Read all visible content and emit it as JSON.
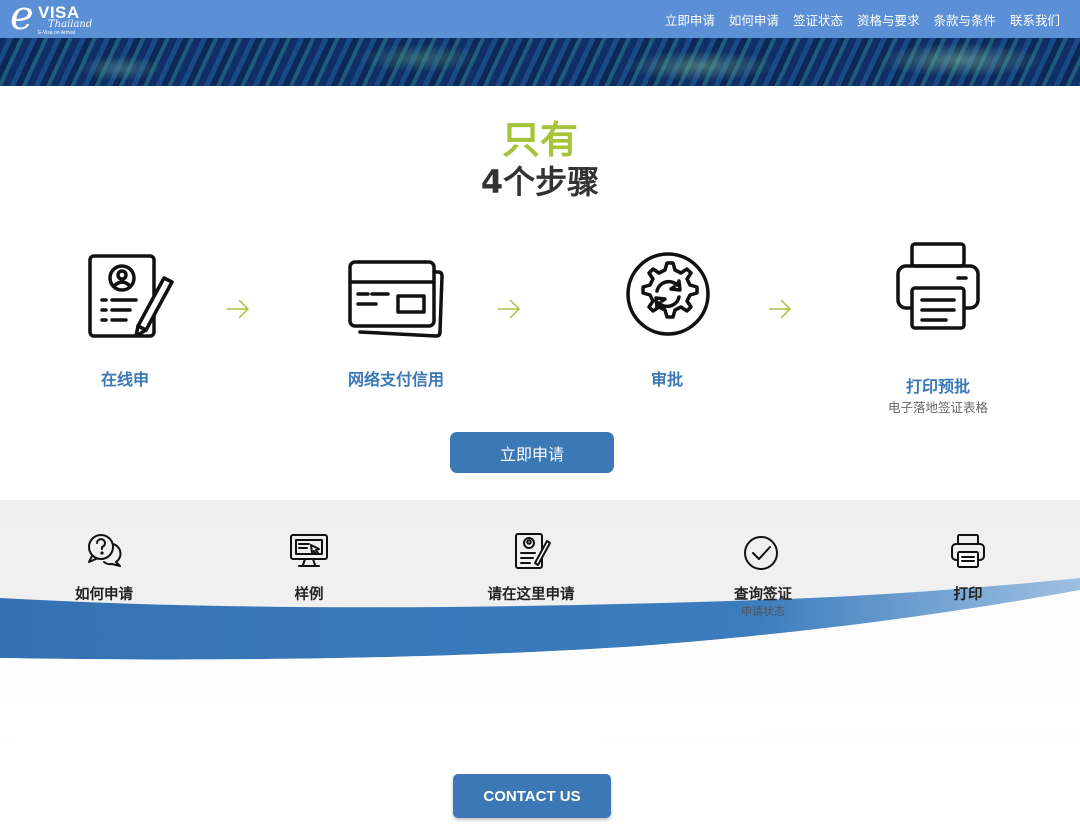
{
  "header": {
    "logo": {
      "e": "e",
      "visa": "VISA",
      "country": "Thailand",
      "tagline": "E-Visa on Arrival"
    },
    "nav": [
      "立即申请",
      "如何申请",
      "签证状态",
      "资格与要求",
      "条款与条件",
      "联系我们"
    ]
  },
  "hero": {
    "line1": "只有",
    "line2": "4个步骤"
  },
  "steps": [
    {
      "icon": "application-form-icon",
      "label": "在线申",
      "sub": ""
    },
    {
      "icon": "credit-card-icon",
      "label": "网络支付信用",
      "sub": ""
    },
    {
      "icon": "approval-gear-icon",
      "label": "审批",
      "sub": ""
    },
    {
      "icon": "printer-icon",
      "label": "打印预批",
      "sub": "电子落地签证表格"
    }
  ],
  "apply_button": "立即申请",
  "quick_links": [
    {
      "icon": "help-chat-icon",
      "label": "如何申请",
      "sub": ""
    },
    {
      "icon": "computer-sample-icon",
      "label": "样例",
      "sub": ""
    },
    {
      "icon": "form-pen-icon",
      "label": "请在这里申请",
      "sub": ""
    },
    {
      "icon": "check-circle-icon",
      "label": "查询签证",
      "sub": "申请状态"
    },
    {
      "icon": "printer-icon",
      "label": "打印",
      "sub": ""
    }
  ],
  "contact_button": "CONTACT US",
  "colors": {
    "topbar": "#5b8fd6",
    "accent_blue": "#3b78b5",
    "accent_green": "#a5c43a"
  }
}
